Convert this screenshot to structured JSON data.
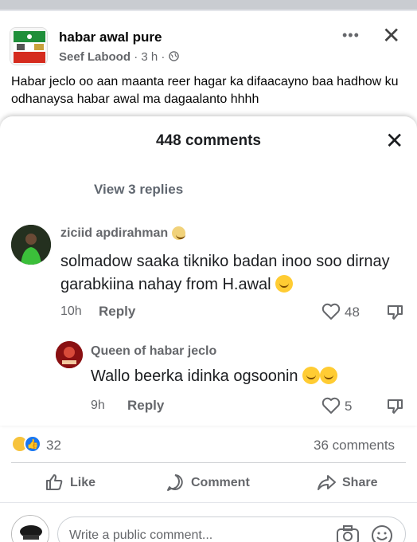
{
  "post": {
    "group_name": "habar awal pure",
    "author": "Seef Labood",
    "time": "3 h",
    "text": "Habar jeclo oo aan maanta reer hagar ka difaacayno baa hadhow ku odhanaysa habar awal ma dagaalanto hhhh"
  },
  "comments_sheet": {
    "title": "448 comments",
    "view_replies": "View 3 replies",
    "comments": [
      {
        "name": "ziciid apdirahman",
        "text": "solmadow saaka tikniko badan inoo soo dirnay garabkiina nahay from H.awal",
        "time": "10h",
        "reply_label": "Reply",
        "likes": "48"
      },
      {
        "name": "Queen of habar jeclo",
        "text": "Wallo beerka idinka ogsoonin",
        "time": "9h",
        "reply_label": "Reply",
        "likes": "5"
      }
    ]
  },
  "footer": {
    "reaction_count": "32",
    "comments_count": "36 comments",
    "like_label": "Like",
    "comment_label": "Comment",
    "share_label": "Share",
    "placeholder": "Write a public comment..."
  },
  "icons": [
    "more-icon",
    "close-icon",
    "globe-icon",
    "like-icon",
    "dislike-icon",
    "comment-icon",
    "share-icon",
    "camera-icon",
    "smile-icon"
  ],
  "colors": {
    "like_blue": "#1877f2",
    "haha_yellow": "#f7c33c",
    "secondary_text": "#65676b"
  }
}
